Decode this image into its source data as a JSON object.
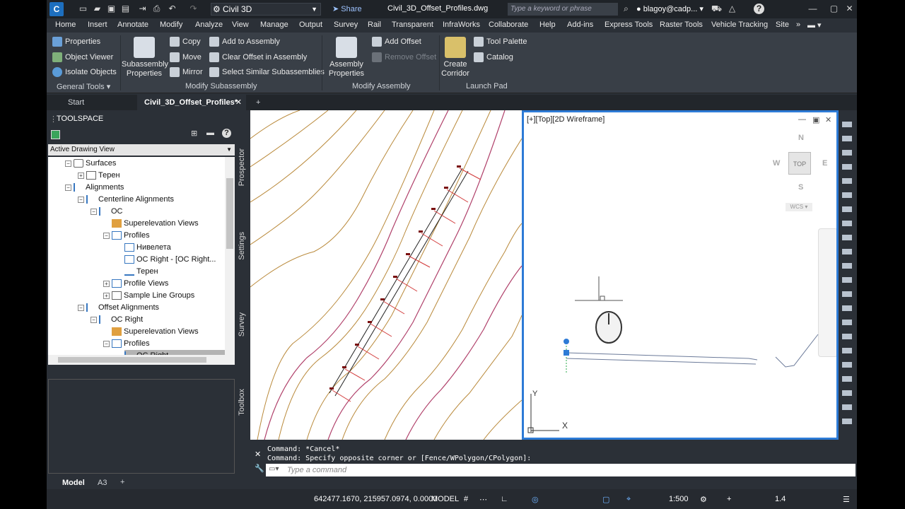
{
  "titlebar": {
    "workspace": "Civil 3D",
    "share": "Share",
    "document": "Civil_3D_Offset_Profiles.dwg",
    "search_placeholder": "Type a keyword or phrase",
    "user": "blagoy@cadp..."
  },
  "menu": [
    "Home",
    "Insert",
    "Annotate",
    "Modify",
    "Analyze",
    "View",
    "Manage",
    "Output",
    "Survey",
    "Rail",
    "Transparent",
    "InfraWorks",
    "Collaborate",
    "Help",
    "Add-ins",
    "Express Tools",
    "Raster Tools",
    "Vehicle Tracking",
    "Site"
  ],
  "ribbon": {
    "general": {
      "properties": "Properties",
      "object_viewer": "Object Viewer",
      "isolate": "Isolate Objects",
      "label": "General Tools"
    },
    "modify_sub": {
      "subassembly_props": "Subassembly Properties",
      "copy": "Copy",
      "move": "Move",
      "mirror": "Mirror",
      "add_to_assembly": "Add to Assembly",
      "clear_offset": "Clear Offset in Assembly",
      "select_similar": "Select Similar Subassemblies",
      "label": "Modify Subassembly"
    },
    "modify_asm": {
      "assembly_props": "Assembly Properties",
      "add_offset": "Add Offset",
      "remove_offset": "Remove Offset",
      "label": "Modify Assembly"
    },
    "launch": {
      "create_corridor": "Create Corridor",
      "tool_palette": "Tool Palette",
      "catalog": "Catalog",
      "label": "Launch Pad"
    }
  },
  "tabs": {
    "start": "Start",
    "active": "Civil_3D_Offset_Profiles*"
  },
  "toolspace": {
    "title": "TOOLSPACE",
    "view": "Active Drawing View",
    "side_tabs": [
      "Prospector",
      "Settings",
      "Survey",
      "Toolbox"
    ],
    "tree": [
      "Surfaces",
      "Терен",
      "Alignments",
      "Centerline Alignments",
      "OC",
      "Superelevation Views",
      "Profiles",
      "Нивелета",
      "OC Right - [OC Right...",
      "Терен",
      "Profile Views",
      "Sample Line Groups",
      "Offset Alignments",
      "OC Right",
      "Superelevation Views",
      "Profiles",
      "OC Right"
    ]
  },
  "viewport": {
    "label": "[+][Top][2D Wireframe]",
    "compass": {
      "n": "N",
      "s": "S",
      "e": "E",
      "w": "W",
      "top": "TOP",
      "wcs": "WCS"
    },
    "ucs_y": "Y",
    "ucs_x": "X"
  },
  "command": {
    "line1": "Command: *Cancel*",
    "line2": "Command: Specify opposite corner or [Fence/WPolygon/CPolygon]:",
    "placeholder": "Type a command"
  },
  "layouts": {
    "model": "Model",
    "a3": "A3"
  },
  "status": {
    "coords": "642477.1670, 215957.0974, 0.0000",
    "mode": "MODEL",
    "scale": "1:500",
    "value": "1.4"
  },
  "colors": {
    "accent": "#2d7bd6",
    "contour_brown": "#b9893a",
    "contour_red": "#b0406a"
  }
}
